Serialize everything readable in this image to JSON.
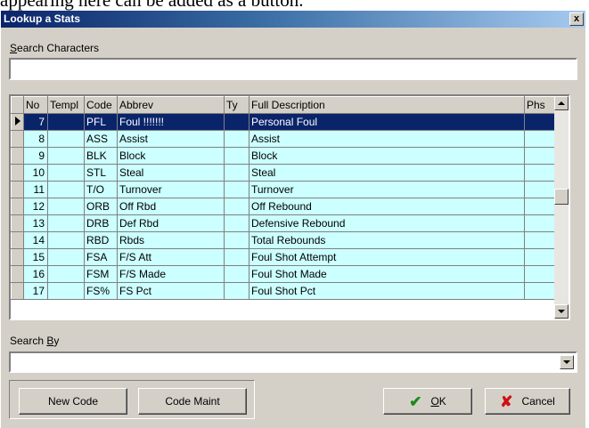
{
  "page_top_text": "appearing here can be added as a button.",
  "window": {
    "title": "Lookup a Stats",
    "close_label": "x"
  },
  "search_characters": {
    "label_accel": "S",
    "label_rest": "earch Characters",
    "value": ""
  },
  "grid": {
    "columns": [
      "No",
      "Templ",
      "Code",
      "Abbrev",
      "Ty",
      "Full Description",
      "Phs"
    ],
    "rows": [
      {
        "no": "7",
        "templ": "",
        "code": "PFL",
        "abbrev": "Foul !!!!!!!",
        "ty": "",
        "desc": "Personal Foul",
        "phs": ""
      },
      {
        "no": "8",
        "templ": "",
        "code": "ASS",
        "abbrev": "Assist",
        "ty": "",
        "desc": "Assist",
        "phs": ""
      },
      {
        "no": "9",
        "templ": "",
        "code": "BLK",
        "abbrev": "Block",
        "ty": "",
        "desc": "Block",
        "phs": ""
      },
      {
        "no": "10",
        "templ": "",
        "code": "STL",
        "abbrev": "Steal",
        "ty": "",
        "desc": "Steal",
        "phs": ""
      },
      {
        "no": "11",
        "templ": "",
        "code": "T/O",
        "abbrev": "Turnover",
        "ty": "",
        "desc": "Turnover",
        "phs": ""
      },
      {
        "no": "12",
        "templ": "",
        "code": "ORB",
        "abbrev": "Off Rbd",
        "ty": "",
        "desc": "Off Rebound",
        "phs": ""
      },
      {
        "no": "13",
        "templ": "",
        "code": "DRB",
        "abbrev": "Def Rbd",
        "ty": "",
        "desc": "Defensive Rebound",
        "phs": ""
      },
      {
        "no": "14",
        "templ": "",
        "code": "RBD",
        "abbrev": "Rbds",
        "ty": "",
        "desc": "Total Rebounds",
        "phs": ""
      },
      {
        "no": "15",
        "templ": "",
        "code": "FSA",
        "abbrev": "F/S Att",
        "ty": "",
        "desc": "Foul Shot Attempt",
        "phs": ""
      },
      {
        "no": "16",
        "templ": "",
        "code": "FSM",
        "abbrev": "F/S Made",
        "ty": "",
        "desc": "Foul Shot Made",
        "phs": ""
      },
      {
        "no": "17",
        "templ": "",
        "code": "FS%",
        "abbrev": "FS Pct",
        "ty": "",
        "desc": "Foul Shot Pct",
        "phs": ""
      }
    ],
    "selected_row": 0,
    "row_color": "#ccffff",
    "selected_color": "#0a246a"
  },
  "search_by": {
    "label_pre": "Search ",
    "label_accel": "B",
    "label_post": "y",
    "value": ""
  },
  "buttons": {
    "new_code": "New Code",
    "code_maint": "Code Maint",
    "ok_accel": "O",
    "ok_rest": "K",
    "cancel": "Cancel"
  },
  "icons": {
    "ok": "checkmark-icon",
    "cancel": "red-x-icon"
  }
}
